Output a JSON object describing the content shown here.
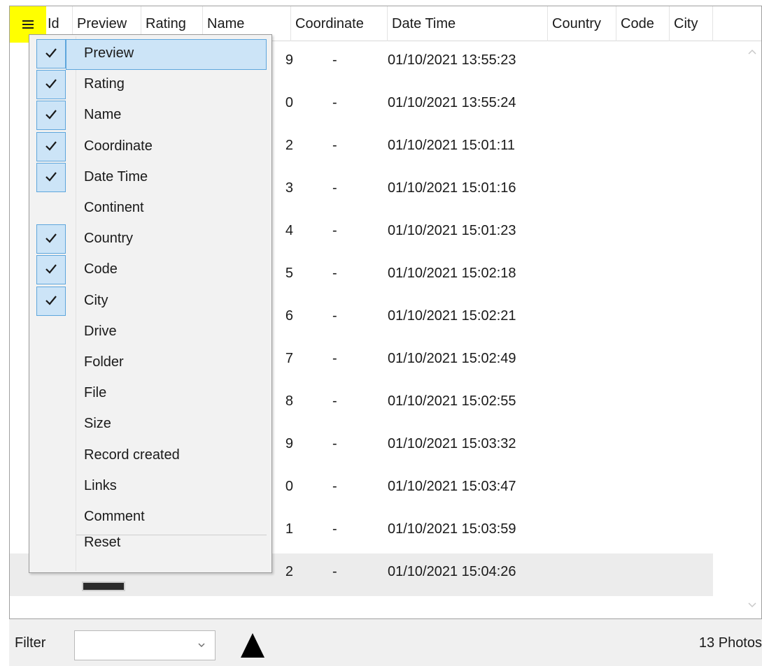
{
  "grid": {
    "columns": [
      {
        "key": "id",
        "label": "Id"
      },
      {
        "key": "preview",
        "label": "Preview"
      },
      {
        "key": "rating",
        "label": "Rating"
      },
      {
        "key": "name",
        "label": "Name"
      },
      {
        "key": "coordinate",
        "label": "Coordinate"
      },
      {
        "key": "datetime",
        "label": "Date Time"
      },
      {
        "key": "country",
        "label": "Country"
      },
      {
        "key": "code",
        "label": "Code"
      },
      {
        "key": "city",
        "label": "City"
      }
    ],
    "rows": [
      {
        "id": "9",
        "coordinate": "-",
        "datetime": "01/10/2021 13:55:23"
      },
      {
        "id": "0",
        "coordinate": "-",
        "datetime": "01/10/2021 13:55:24"
      },
      {
        "id": "2",
        "coordinate": "-",
        "datetime": "01/10/2021 15:01:11"
      },
      {
        "id": "3",
        "coordinate": "-",
        "datetime": "01/10/2021 15:01:16"
      },
      {
        "id": "4",
        "coordinate": "-",
        "datetime": "01/10/2021 15:01:23"
      },
      {
        "id": "5",
        "coordinate": "-",
        "datetime": "01/10/2021 15:02:18"
      },
      {
        "id": "6",
        "coordinate": "-",
        "datetime": "01/10/2021 15:02:21"
      },
      {
        "id": "7",
        "coordinate": "-",
        "datetime": "01/10/2021 15:02:49"
      },
      {
        "id": "8",
        "coordinate": "-",
        "datetime": "01/10/2021 15:02:55"
      },
      {
        "id": "9",
        "coordinate": "-",
        "datetime": "01/10/2021 15:03:32"
      },
      {
        "id": "0",
        "coordinate": "-",
        "datetime": "01/10/2021 15:03:47"
      },
      {
        "id": "1",
        "coordinate": "-",
        "datetime": "01/10/2021 15:03:59"
      },
      {
        "id": "2",
        "coordinate": "-",
        "datetime": "01/10/2021 15:04:26",
        "selected": true
      }
    ]
  },
  "column_menu": {
    "items": [
      {
        "label": "Preview",
        "checked": true,
        "highlighted": true
      },
      {
        "label": "Rating",
        "checked": true
      },
      {
        "label": "Name",
        "checked": true
      },
      {
        "label": "Coordinate",
        "checked": true
      },
      {
        "label": "Date Time",
        "checked": true
      },
      {
        "label": "Continent",
        "checked": false
      },
      {
        "label": "Country",
        "checked": true
      },
      {
        "label": "Code",
        "checked": true
      },
      {
        "label": "City",
        "checked": true
      },
      {
        "label": "Drive",
        "checked": false
      },
      {
        "label": "Folder",
        "checked": false
      },
      {
        "label": "File",
        "checked": false
      },
      {
        "label": "Size",
        "checked": false
      },
      {
        "label": "Record created",
        "checked": false
      },
      {
        "label": "Links",
        "checked": false
      },
      {
        "label": "Comment",
        "checked": false
      }
    ],
    "reset_label": "Reset"
  },
  "footer": {
    "filter_label": "Filter",
    "filter_value": "",
    "photo_count": "13 Photos"
  },
  "icons": {
    "menu": "hamburger-icon",
    "check": "checkmark-icon",
    "sort": "triangle-up-icon",
    "dropdown": "chevron-down-icon"
  },
  "colors": {
    "menu_button_highlight": "#ffff00",
    "selection_fill": "#cce4f7",
    "selection_border": "#5ea6dc",
    "selected_row": "#ececec"
  }
}
